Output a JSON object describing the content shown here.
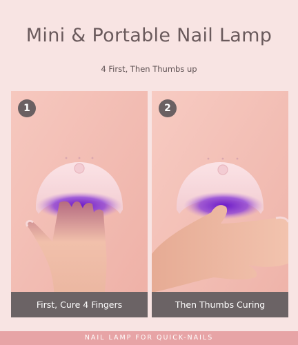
{
  "header": {
    "title": "Mini & Portable Nail Lamp",
    "subtitle": "4 First, Then Thumbs up"
  },
  "steps": [
    {
      "number": "1",
      "caption": "First, Cure 4 Fingers"
    },
    {
      "number": "2",
      "caption": "Then Thumbs Curing"
    }
  ],
  "footer": {
    "text": "NAIL LAMP FOR QUICK-NAILS"
  },
  "colors": {
    "background": "#f8e4e3",
    "lamp": "#f6d6da",
    "uv_glow": "#7b2bd0",
    "caption_bar": "#6b6365",
    "footer_bar": "#e7a4a6"
  }
}
